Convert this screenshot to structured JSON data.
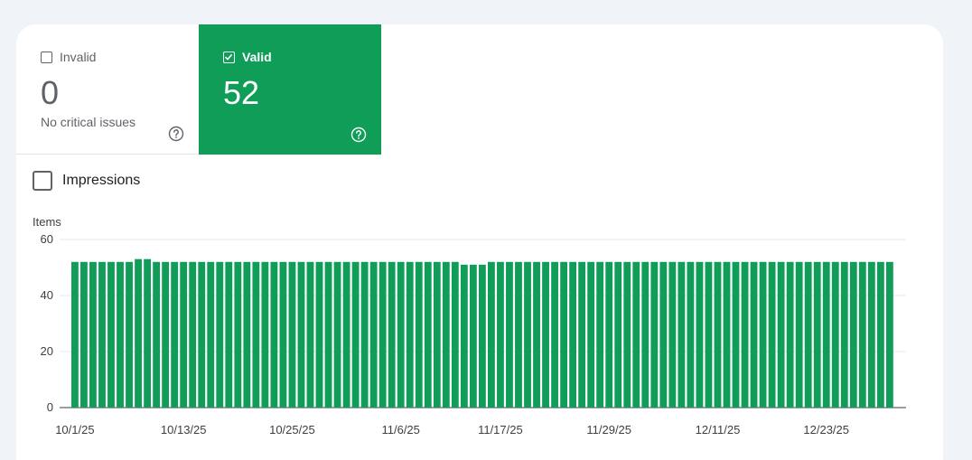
{
  "tiles": {
    "invalid": {
      "label": "Invalid",
      "count": "0",
      "subtitle": "No critical issues",
      "checked": false
    },
    "valid": {
      "label": "Valid",
      "count": "52",
      "checked": true
    }
  },
  "metric_toggle": {
    "label": "Impressions",
    "checked": false
  },
  "colors": {
    "valid_green": "#0f9d58",
    "background": "#f0f4f9"
  },
  "chart_data": {
    "type": "bar",
    "ylabel": "Items",
    "ylim": [
      0,
      60
    ],
    "yticks": [
      0,
      20,
      40,
      60
    ],
    "x_tick_labels": [
      "10/1/25",
      "10/13/25",
      "10/25/25",
      "11/6/25",
      "11/17/25",
      "11/29/25",
      "12/11/25",
      "12/23/25"
    ],
    "start_date": "10/1/25",
    "end_date": "12/30/25",
    "values": [
      52,
      52,
      52,
      52,
      52,
      52,
      52,
      53,
      53,
      52,
      52,
      52,
      52,
      52,
      52,
      52,
      52,
      52,
      52,
      52,
      52,
      52,
      52,
      52,
      52,
      52,
      52,
      52,
      52,
      52,
      52,
      52,
      52,
      52,
      52,
      52,
      52,
      52,
      52,
      52,
      52,
      52,
      52,
      51,
      51,
      51,
      52,
      52,
      52,
      52,
      52,
      52,
      52,
      52,
      52,
      52,
      52,
      52,
      52,
      52,
      52,
      52,
      52,
      52,
      52,
      52,
      52,
      52,
      52,
      52,
      52,
      52,
      52,
      52,
      52,
      52,
      52,
      52,
      52,
      52,
      52,
      52,
      52,
      52,
      52,
      52,
      52,
      52,
      52,
      52,
      52
    ],
    "color": "#0f9d58",
    "grid": true
  }
}
